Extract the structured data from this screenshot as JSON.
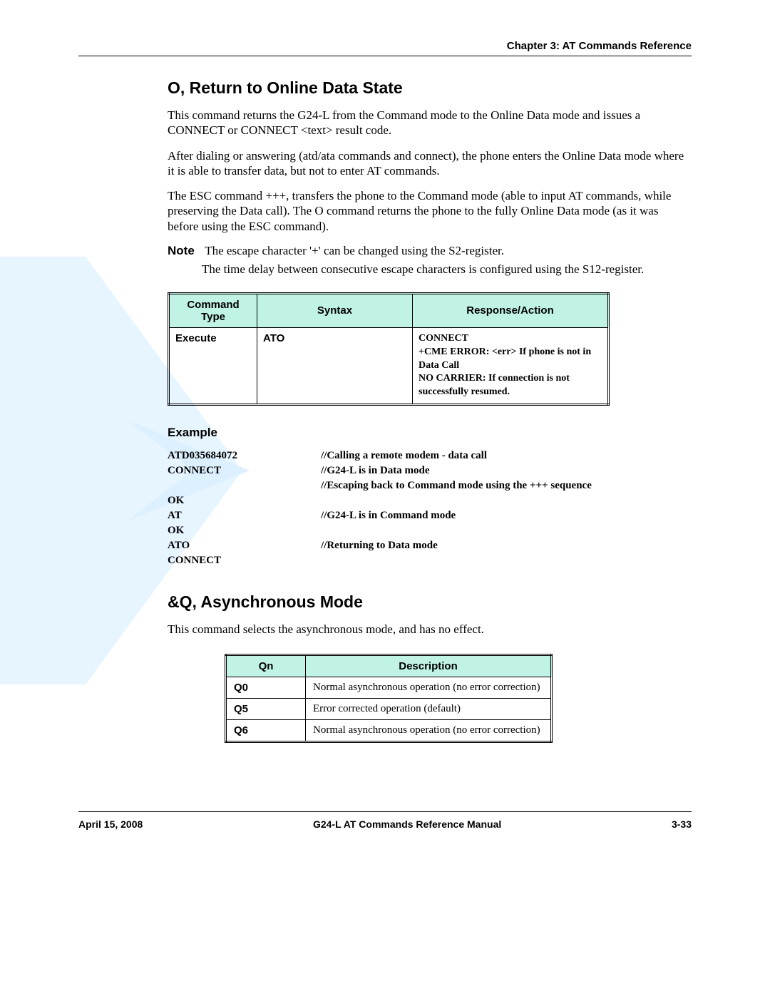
{
  "header": {
    "chapter": "Chapter 3:  AT Commands Reference"
  },
  "section1": {
    "title": "O, Return to Online Data State",
    "p1": "This command returns the G24-L from the Command mode to the Online Data mode and issues a CONNECT or CONNECT <text> result code.",
    "p2": "After dialing or answering (atd/ata commands and connect), the phone enters the Online Data mode where it is able to transfer data, but not to enter AT commands.",
    "p3": "The ESC command +++, transfers the phone to the Command mode (able to input AT commands, while preserving the Data call). The O command returns the phone to the fully Online Data mode (as it was before using the ESC command).",
    "note_label": "Note",
    "note1": "The escape character '+' can be changed using the S2-register.",
    "note2": "The time delay between consecutive escape characters is configured using the S12-register.",
    "table": {
      "h1": "Command Type",
      "h2": "Syntax",
      "h3": "Response/Action",
      "r1c1": "Execute",
      "r1c2": "ATO",
      "r1c3_l1": "CONNECT",
      "r1c3_l2": "+CME ERROR: <err> If phone is not in Data Call",
      "r1c3_l3": "NO CARRIER: If connection is not successfully resumed."
    },
    "example_h": "Example",
    "example": [
      {
        "c1": "ATD035684072",
        "c2": "//Calling a remote modem - data call"
      },
      {
        "c1": "CONNECT",
        "c2": "//G24-L is in Data mode"
      },
      {
        "c1": "",
        "c2": "//Escaping back to Command mode using the +++ sequence"
      },
      {
        "c1": "OK",
        "c2": ""
      },
      {
        "c1": "AT",
        "c2": "//G24-L is in Command mode"
      },
      {
        "c1": "OK",
        "c2": ""
      },
      {
        "c1": "ATO",
        "c2": "//Returning to Data mode"
      },
      {
        "c1": "CONNECT",
        "c2": ""
      }
    ]
  },
  "section2": {
    "title": "&Q, Asynchronous Mode",
    "p1": "This command selects the asynchronous mode, and has no effect.",
    "table": {
      "h1": "Qn",
      "h2": "Description",
      "rows": [
        {
          "q": "Q0",
          "d": "Normal asynchronous operation (no error correction)"
        },
        {
          "q": "Q5",
          "d": "Error corrected operation (default)"
        },
        {
          "q": "Q6",
          "d": "Normal asynchronous operation (no error correction)"
        }
      ]
    }
  },
  "footer": {
    "date": "April 15, 2008",
    "title": "G24-L AT Commands Reference Manual",
    "page": "3-33"
  }
}
